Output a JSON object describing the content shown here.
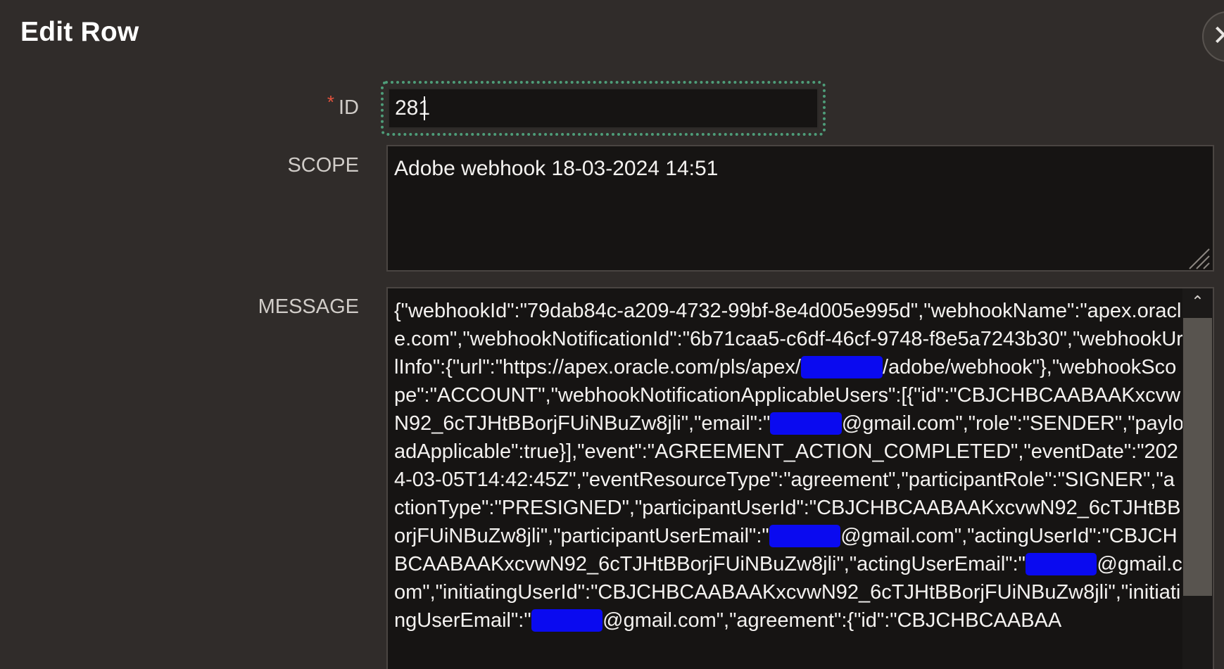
{
  "dialog": {
    "title": "Edit Row",
    "close_icon": "close-icon",
    "close_glyph": "✕"
  },
  "fields": {
    "id": {
      "required_mark": "*",
      "label": "ID",
      "value": "281"
    },
    "scope": {
      "label": "SCOPE",
      "value": "Adobe webhook 18-03-2024 14:51"
    },
    "message": {
      "label": "MESSAGE",
      "segments": [
        "{\"webhookId\":\"79dab84c-a209-4732-99bf-8e4d005e995d\",\"webhookName\":\"apex.oracle.com\",\"webhookNotificationId\":\"6b71caa5-c6df-46cf-9748-f8e5a7243b30\",\"webhookUrlInfo\":{\"url\":\"https://apex.oracle.com/pls/apex/",
        "/adobe/webhook\"},\"webhookScope\":\"ACCOUNT\",\"webhookNotificationApplicableUsers\":[{\"id\":\"CBJCHBCAABAAKxcvwN92_6cTJHtBBorjFUiNBuZw8jli\",\"email\":\"",
        "@gmail.com\",\"role\":\"SENDER\",\"payloadApplicable\":true}],\"event\":\"AGREEMENT_ACTION_COMPLETED\",\"eventDate\":\"2024-03-05T14:42:45Z\",\"eventResourceType\":\"agreement\",\"participantRole\":\"SIGNER\",\"actionType\":\"PRESIGNED\",\"participantUserId\":\"CBJCHBCAABAAKxcvwN92_6cTJHtBBorjFUiNBuZw8jli\",\"participantUserEmail\":\"",
        "@gmail.com\",\"actingUserId\":\"CBJCHBCAABAAKxcvwN92_6cTJHtBBorjFUiNBuZw8jli\",\"actingUserEmail\":\"",
        "@gmail.com\",\"initiatingUserId\":\"CBJCHBCAABAAKxcvwN92_6cTJHtBBorjFUiNBuZw8jli\",\"initiatingUserEmail\":\"",
        "@gmail.com\",\"agreement\":{\"id\":\"CBJCHBCAABAA"
      ]
    }
  },
  "colors": {
    "background": "#302c2a",
    "field_background": "#161413",
    "focus_ring": "#4e9d79",
    "required": "#e5533d",
    "redaction": "#0a0af0"
  }
}
